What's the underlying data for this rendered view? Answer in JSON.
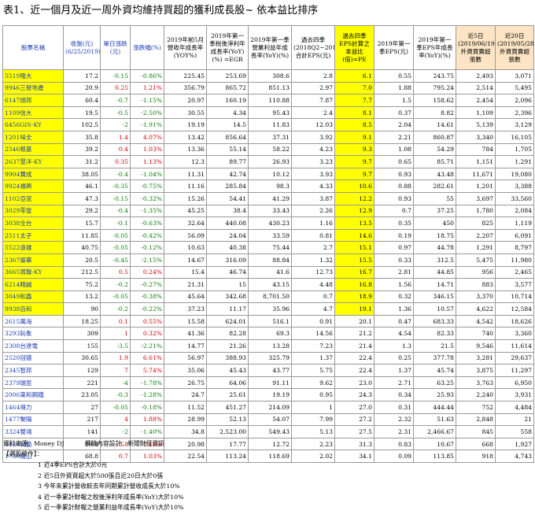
{
  "title": "表1、近一個月及近一周外資均維持買超的獲利成長股~ 依本益比排序",
  "headers": [
    "股票名稱",
    "收盤(元) (6/25/2019)",
    "單日漲跌 (元)",
    "漲跌幅(%)",
    "2019年前5月營收年成長率 (YOY%)",
    "2019年第一季稅後淨利年成長率(YoY)(%) =EGR",
    "2019年第一季營業利益年成長率(YoY)(%)",
    "過去四季 (2018Q2~2019Q1) 合計EPS(元)",
    "過去四季EPS計算之本益比 (倍)=PE",
    "2019年第一季EPS(元)",
    "2019年第一季EPS年成長率(YoY)(%)",
    "近5日 (2019/06/19~6/25) 外資買賣超張數",
    "近20日 (2019/05/28~6/25) 外資買賣超張數"
  ],
  "rows": [
    {
      "name": "5519隆大",
      "close": "17.2",
      "chg": "-0.15",
      "pct": "-0.86%",
      "rev": "225.45",
      "ni": "253.69",
      "op": "308.6",
      "eps4": "2.8",
      "pe": "6.1",
      "eps1": "0.55",
      "epsg": "243.75",
      "f5": "2,493",
      "f20": "3,071",
      "hl": true
    },
    {
      "name": "9946三發地產",
      "close": "20.9",
      "chg": "0.25",
      "pct": "1.21%",
      "rev": "356.79",
      "ni": "865.72",
      "op": "851.13",
      "eps4": "2.97",
      "pe": "7.0",
      "eps1": "1.88",
      "epsg": "795.24",
      "f5": "2,514",
      "f20": "5,495",
      "hl": true
    },
    {
      "name": "6147頎邦",
      "close": "60.4",
      "chg": "-0.7",
      "pct": "-1.15%",
      "rev": "20.97",
      "ni": "160.19",
      "op": "110.88",
      "eps4": "7.87",
      "pe": "7.7",
      "eps1": "1.5",
      "epsg": "158.62",
      "f5": "2,454",
      "f20": "2,096",
      "hl": true
    },
    {
      "name": "1109信大",
      "close": "19.5",
      "chg": "-0.5",
      "pct": "-2.50%",
      "rev": "30.55",
      "ni": "4.34",
      "op": "95.43",
      "eps4": "2.4",
      "pe": "8.1",
      "eps1": "0.37",
      "epsg": "8.82",
      "f5": "1,109",
      "f20": "2,396",
      "hl": true
    },
    {
      "name": "6456GIS-KY",
      "close": "102.5",
      "chg": "-2",
      "pct": "-1.91%",
      "rev": "19.19",
      "ni": "14.5",
      "op": "11.83",
      "eps4": "12.03",
      "pe": "8.5",
      "eps1": "2.04",
      "epsg": "14.61",
      "f5": "5,139",
      "f20": "3,129",
      "hl": true
    },
    {
      "name": "1201味全",
      "close": "35.8",
      "chg": "1.4",
      "pct": "4.07%",
      "rev": "13.42",
      "ni": "856.64",
      "op": "37.31",
      "eps4": "3.92",
      "pe": "9.1",
      "eps1": "2.21",
      "epsg": "860.87",
      "f5": "3,340",
      "f20": "16,105",
      "hl": true
    },
    {
      "name": "2546根基",
      "close": "39.2",
      "chg": "0.4",
      "pct": "1.03%",
      "rev": "13.36",
      "ni": "55.14",
      "op": "58.22",
      "eps4": "4.23",
      "pe": "9.3",
      "eps1": "1.08",
      "epsg": "54.29",
      "f5": "784",
      "f20": "1,705",
      "hl": true
    },
    {
      "name": "2637慧洋-KY",
      "close": "31.2",
      "chg": "0.35",
      "pct": "1.13%",
      "rev": "12.3",
      "ni": "89.77",
      "op": "26.93",
      "eps4": "3.23",
      "pe": "9.7",
      "eps1": "0.65",
      "epsg": "85.71",
      "f5": "1,151",
      "f20": "1,291",
      "hl": true
    },
    {
      "name": "9904寶成",
      "close": "38.05",
      "chg": "-0.4",
      "pct": "-1.04%",
      "rev": "11.31",
      "ni": "42.74",
      "op": "10.12",
      "eps4": "3.93",
      "pe": "9.7",
      "eps1": "0.93",
      "epsg": "43.48",
      "f5": "11,671",
      "f20": "19,080",
      "hl": true
    },
    {
      "name": "9924福興",
      "close": "46.1",
      "chg": "-0.35",
      "pct": "-0.75%",
      "rev": "11.16",
      "ni": "285.84",
      "op": "98.3",
      "eps4": "4.33",
      "pe": "10.6",
      "eps1": "0.88",
      "epsg": "282.61",
      "f5": "1,201",
      "f20": "3,388",
      "hl": true
    },
    {
      "name": "1102亞泥",
      "close": "47.3",
      "chg": "-0.15",
      "pct": "-0.32%",
      "rev": "15.26",
      "ni": "54.41",
      "op": "41.29",
      "eps4": "3.87",
      "pe": "12.2",
      "eps1": "0.93",
      "epsg": "55",
      "f5": "3,697",
      "f20": "33,560",
      "hl": true
    },
    {
      "name": "3029零壹",
      "close": "29.2",
      "chg": "-0.4",
      "pct": "-1.35%",
      "rev": "45.25",
      "ni": "38.4",
      "op": "33.43",
      "eps4": "2.26",
      "pe": "12.9",
      "eps1": "0.7",
      "epsg": "37.25",
      "f5": "1,780",
      "f20": "2,084",
      "hl": true
    },
    {
      "name": "3038全台",
      "close": "15.7",
      "chg": "-0.1",
      "pct": "-0.63%",
      "rev": "32.64",
      "ni": "440.08",
      "op": "430.23",
      "eps4": "1.16",
      "pe": "13.5",
      "eps1": "0.35",
      "epsg": "450",
      "f5": "825",
      "f20": "1,119",
      "hl": true
    },
    {
      "name": "2511太子",
      "close": "11.85",
      "chg": "-0.05",
      "pct": "-0.42%",
      "rev": "56.09",
      "ni": "24.04",
      "op": "33.59",
      "eps4": "0.81",
      "pe": "14.6",
      "eps1": "0.19",
      "epsg": "18.75",
      "f5": "2,207",
      "f20": "6,091",
      "hl": true
    },
    {
      "name": "5522遠雄",
      "close": "40.75",
      "chg": "-0.05",
      "pct": "-0.12%",
      "rev": "10.63",
      "ni": "40.38",
      "op": "75.44",
      "eps4": "2.7",
      "pe": "15.1",
      "eps1": "0.97",
      "epsg": "44.78",
      "f5": "1,291",
      "f20": "8,797",
      "hl": true
    },
    {
      "name": "2367燿華",
      "close": "20.5",
      "chg": "-0.45",
      "pct": "-2.15%",
      "rev": "14.67",
      "ni": "316.09",
      "op": "88.84",
      "eps4": "1.32",
      "pe": "15.5",
      "eps1": "0.33",
      "epsg": "312.5",
      "f5": "5,475",
      "f20": "11,980",
      "hl": true
    },
    {
      "name": "3665貿聯-KY",
      "close": "212.5",
      "chg": "0.5",
      "pct": "0.24%",
      "rev": "15.4",
      "ni": "46.74",
      "op": "41.6",
      "eps4": "12.73",
      "pe": "16.7",
      "eps1": "2.81",
      "epsg": "44.85",
      "f5": "956",
      "f20": "2,465",
      "hl": true
    },
    {
      "name": "6214精誠",
      "close": "75.2",
      "chg": "-0.2",
      "pct": "-0.27%",
      "rev": "21.31",
      "ni": "15",
      "op": "43.15",
      "eps4": "4.48",
      "pe": "16.8",
      "eps1": "1.56",
      "epsg": "14.71",
      "f5": "883",
      "f20": "3,577",
      "hl": true
    },
    {
      "name": "3049和鑫",
      "close": "13.2",
      "chg": "-0.05",
      "pct": "-0.38%",
      "rev": "45.64",
      "ni": "342.68",
      "op": "8,701.50",
      "eps4": "0.7",
      "pe": "18.9",
      "eps1": "0.32",
      "epsg": "346.15",
      "f5": "3,370",
      "f20": "10,714",
      "hl": true
    },
    {
      "name": "9938百和",
      "close": "90",
      "chg": "-0.2",
      "pct": "-0.22%",
      "rev": "37.23",
      "ni": "11.17",
      "op": "35.96",
      "eps4": "4.7",
      "pe": "19.1",
      "eps1": "1.36",
      "epsg": "10.57",
      "f5": "4,622",
      "f20": "12,584",
      "hl": true
    },
    {
      "name": "2615萬海",
      "close": "18.25",
      "chg": "0.1",
      "pct": "0.55%",
      "rev": "15.58",
      "ni": "624.01",
      "op": "516.1",
      "eps4": "0.91",
      "pe": "20.1",
      "eps1": "0.47",
      "epsg": "683.33",
      "f5": "4,542",
      "f20": "18,626",
      "hl": false
    },
    {
      "name": "3293鈊象",
      "close": "309",
      "chg": "1",
      "pct": "0.32%",
      "rev": "41.36",
      "ni": "82.28",
      "op": "69.3",
      "eps4": "14.56",
      "pe": "21.2",
      "eps1": "4.54",
      "epsg": "82.33",
      "f5": "740",
      "f20": "3,360",
      "hl": false
    },
    {
      "name": "2308台達電",
      "close": "155",
      "chg": "-3.5",
      "pct": "-2.21%",
      "rev": "14.77",
      "ni": "21.26",
      "op": "13.28",
      "eps4": "7.23",
      "pe": "21.4",
      "eps1": "1.3",
      "epsg": "21.5",
      "f5": "9,546",
      "f20": "11,614",
      "hl": false
    },
    {
      "name": "2520冠德",
      "close": "30.65",
      "chg": "1.9",
      "pct": "6.61%",
      "rev": "56.97",
      "ni": "388.93",
      "op": "325.79",
      "eps4": "1.37",
      "pe": "22.4",
      "eps1": "0.25",
      "epsg": "377.78",
      "f5": "3,281",
      "f20": "29,637",
      "hl": false
    },
    {
      "name": "2345智邦",
      "close": "129",
      "chg": "7",
      "pct": "5.74%",
      "rev": "35.06",
      "ni": "45.43",
      "op": "43.77",
      "eps4": "5.75",
      "pe": "22.4",
      "eps1": "1.37",
      "epsg": "45.74",
      "f5": "3,875",
      "f20": "11,297",
      "hl": false
    },
    {
      "name": "2379瑞昱",
      "close": "221",
      "chg": "-4",
      "pct": "-1.78%",
      "rev": "26.75",
      "ni": "64.06",
      "op": "91.11",
      "eps4": "9.62",
      "pe": "23.0",
      "eps1": "2.71",
      "epsg": "63.25",
      "f5": "3,763",
      "f20": "6,950",
      "hl": false
    },
    {
      "name": "2006東和鋼鐵",
      "close": "23.05",
      "chg": "-0.3",
      "pct": "-1.28%",
      "rev": "24.7",
      "ni": "25.61",
      "op": "19.19",
      "eps4": "0.95",
      "pe": "24.3",
      "eps1": "0.34",
      "epsg": "25.93",
      "f5": "2,240",
      "f20": "3,931",
      "hl": false
    },
    {
      "name": "1464得力",
      "close": "27",
      "chg": "-0.05",
      "pct": "-0.18%",
      "rev": "11.52",
      "ni": "451.27",
      "op": "214.09",
      "eps4": "1",
      "pe": "27.0",
      "eps1": "0.31",
      "epsg": "444.44",
      "f5": "752",
      "f20": "4,484",
      "hl": false
    },
    {
      "name": "1477聚陽",
      "close": "217",
      "chg": "4",
      "pct": "1.88%",
      "rev": "28.99",
      "ni": "52.13",
      "op": "54.07",
      "eps4": "7.99",
      "pe": "27.2",
      "eps1": "2.32",
      "epsg": "51.63",
      "f5": "2,848",
      "f20": "21",
      "hl": false
    },
    {
      "name": "3324雙鴻",
      "close": "141",
      "chg": "-2",
      "pct": "-1.40%",
      "rev": "34.8",
      "ni": "2,523.00",
      "op": "549.43",
      "eps4": "5.13",
      "pe": "27.5",
      "eps1": "2.31",
      "epsg": "2,466.67",
      "f5": "845",
      "f20": "558",
      "hl": false
    },
    {
      "name": "4426利勤",
      "close": "69.8",
      "chg": "0.8",
      "pct": "1.16%",
      "rev": "20.98",
      "ni": "17.77",
      "op": "12.72",
      "eps4": "2.23",
      "pe": "31.3",
      "eps1": "0.83",
      "epsg": "10.67",
      "f5": "668",
      "f20": "1,927",
      "hl": false
    },
    {
      "name": "1736喬山",
      "close": "68.8",
      "chg": "0.7",
      "pct": "1.03%",
      "rev": "22.54",
      "ni": "113.24",
      "op": "118.69",
      "eps4": "2.02",
      "pe": "34.1",
      "eps1": "0.09",
      "epsg": "113.85",
      "f5": "918",
      "f20": "4,743",
      "hl": false
    }
  ],
  "footer": {
    "source": "資料來源：Money DJ",
    "editor": "撰稿內容設計：新聞財經資訊",
    "conditions_title": "【選股條件】：",
    "conditions": [
      "1 近4季EPS合計大於0元",
      "2 近5日外資買超大於500張且近20日大於0張",
      "3 今年來累計營收較去年同期累計營收成長大於10%",
      "4 近一季累計財報之稅後淨利年成長率(YoY)大於10%",
      "5 近一季累計財報之營業利益年成長率(YoY)大於10%"
    ]
  }
}
